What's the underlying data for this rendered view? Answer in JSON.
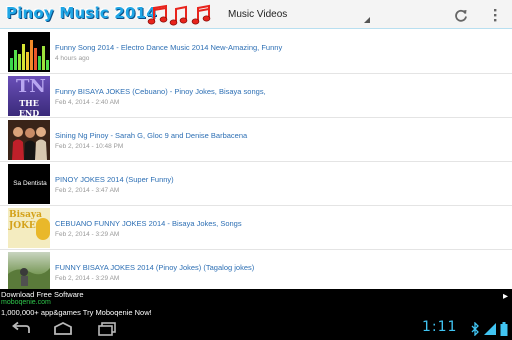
{
  "header": {
    "app_title": "Pinoy Music 2014",
    "spinner_value": "Music Videos",
    "refresh_icon": "refresh-icon",
    "overflow_icon": "overflow-menu-icon"
  },
  "videos": [
    {
      "title": "Funny Song 2014 - Electro Dance Music 2014 New-Amazing, Funny",
      "date": "4 hours ago",
      "thumb_text": "",
      "thumb_icon": "equalizer-thumbnail"
    },
    {
      "title": "Funny BISAYA JOKES (Cebuano) - Pinoy Jokes, Bisaya songs,",
      "date": "Feb 4, 2014 - 2:40 AM",
      "thumb_text": "THE END",
      "thumb_icon": "the-end-thumbnail"
    },
    {
      "title": "Sining Ng Pinoy - Sarah G, Gloc 9 and Denise Barbacena",
      "date": "Feb 2, 2014 - 10:48 PM",
      "thumb_text": "",
      "thumb_icon": "performers-thumbnail"
    },
    {
      "title": "PINOY JOKES 2014 (Super Funny)",
      "date": "Feb 2, 2014 - 3:47 AM",
      "thumb_text": "Sa Dentista",
      "thumb_icon": "sa-dentista-thumbnail"
    },
    {
      "title": "CEBUANO FUNNY JOKES 2014 - Bisaya Jokes, Songs",
      "date": "Feb 2, 2014 - 3:29 AM",
      "thumb_text": "Bisaya JOKES",
      "thumb_icon": "bisaya-jokes-thumbnail"
    },
    {
      "title": "FUNNY BISAYA JOKES 2014 (Pinoy Jokes) (Tagalog jokes)",
      "date": "Feb 2, 2014 - 3:29 AM",
      "thumb_text": "",
      "thumb_icon": "outdoor-thumbnail"
    }
  ],
  "ad": {
    "title": "Download Free Software",
    "url": "moboqenie.com",
    "body": "1,000,000+ app&games Try Moboqenie Now!"
  },
  "system_bar": {
    "clock": "1:11",
    "back_icon": "back-icon",
    "home_icon": "home-icon",
    "recents_icon": "recent-apps-icon"
  },
  "colors": {
    "link": "#2d6fb4",
    "accent": "#1fa6e6",
    "clock": "#41c4f2",
    "notes": "#e8241c"
  }
}
